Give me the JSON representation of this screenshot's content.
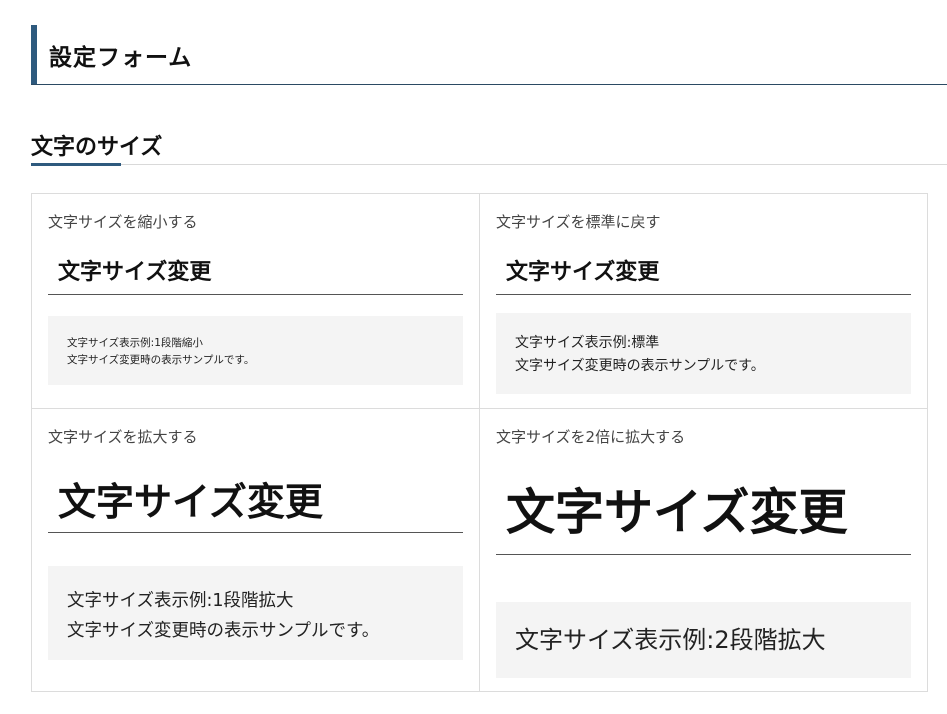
{
  "header": {
    "title": "設定フォーム"
  },
  "section": {
    "title": "文字のサイズ"
  },
  "options": {
    "shrink": {
      "label": "文字サイズを縮小する",
      "button": "文字サイズ変更",
      "preview_line1": "文字サイズ表示例:1段階縮小",
      "preview_line2": "文字サイズ変更時の表示サンプルです。"
    },
    "standard": {
      "label": "文字サイズを標準に戻す",
      "button": "文字サイズ変更",
      "preview_line1": "文字サイズ表示例:標準",
      "preview_line2": "文字サイズ変更時の表示サンプルです。"
    },
    "enlarge": {
      "label": "文字サイズを拡大する",
      "button": "文字サイズ変更",
      "preview_line1": "文字サイズ表示例:1段階拡大",
      "preview_line2": "文字サイズ変更時の表示サンプルです。"
    },
    "double": {
      "label": "文字サイズを2倍に拡大する",
      "button": "文字サイズ変更",
      "preview_line1": "文字サイズ表示例:2段階拡大"
    }
  },
  "colors": {
    "accent": "#2e5a7e",
    "preview_bg": "#f4f4f4",
    "border": "#dcdcdc"
  }
}
